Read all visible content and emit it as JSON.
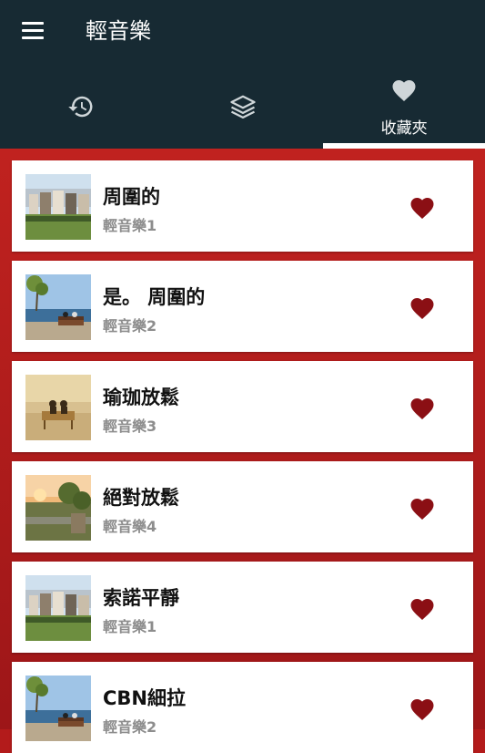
{
  "app": {
    "title": "輕音樂"
  },
  "tabs": [
    {
      "icon": "history-icon",
      "label": ""
    },
    {
      "icon": "layers-icon",
      "label": ""
    },
    {
      "icon": "heart-icon",
      "label": "收藏夾",
      "active": true
    }
  ],
  "items": [
    {
      "title": "周圍的",
      "subtitle": "輕音樂1",
      "thumb": "city-houses"
    },
    {
      "title": "是。 周圍的",
      "subtitle": "輕音樂2",
      "thumb": "bench-sea"
    },
    {
      "title": "瑜珈放鬆",
      "subtitle": "輕音樂3",
      "thumb": "couple-bench"
    },
    {
      "title": "絕對放鬆",
      "subtitle": "輕音樂4",
      "thumb": "sunset-garden"
    },
    {
      "title": "索諾平靜",
      "subtitle": "輕音樂1",
      "thumb": "city-houses"
    },
    {
      "title": "CBN細拉",
      "subtitle": "輕音樂2",
      "thumb": "bench-sea"
    }
  ],
  "colors": {
    "accent": "#b31b1b",
    "appbar": "#172a33",
    "heart": "#8b0f14"
  }
}
